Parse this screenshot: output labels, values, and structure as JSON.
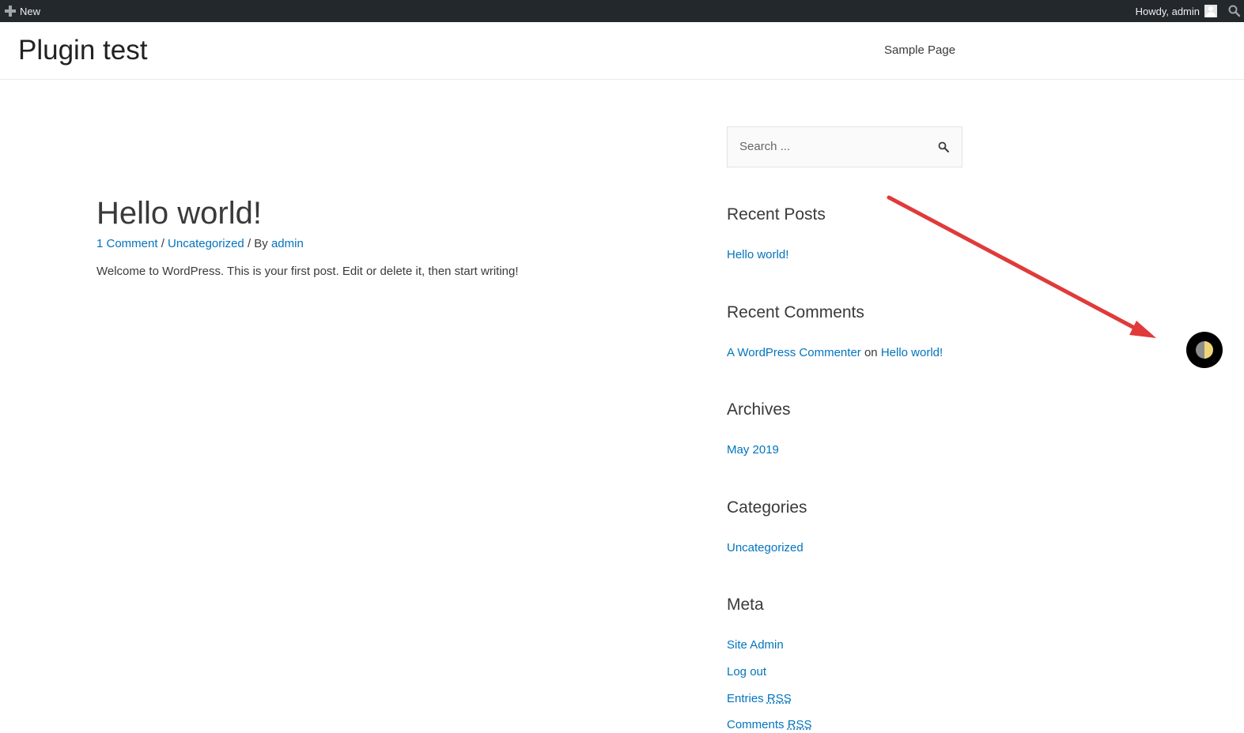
{
  "admin_bar": {
    "new_label": "New",
    "howdy": "Howdy, admin"
  },
  "site": {
    "title": "Plugin test",
    "nav": [
      "Sample Page"
    ]
  },
  "post": {
    "title": "Hello world!",
    "meta": {
      "comments": "1 Comment",
      "sep1": " / ",
      "category": "Uncategorized",
      "sep2": " / By ",
      "author": "admin"
    },
    "excerpt": "Welcome to WordPress. This is your first post. Edit or delete it, then start writing!"
  },
  "sidebar": {
    "search_placeholder": "Search ...",
    "recent_posts": {
      "title": "Recent Posts",
      "items": [
        "Hello world!"
      ]
    },
    "recent_comments": {
      "title": "Recent Comments",
      "author": "A WordPress Commenter",
      "on": " on ",
      "post": "Hello world!"
    },
    "archives": {
      "title": "Archives",
      "items": [
        "May 2019"
      ]
    },
    "categories": {
      "title": "Categories",
      "items": [
        "Uncategorized"
      ]
    },
    "meta": {
      "title": "Meta",
      "site_admin": "Site Admin",
      "log_out": "Log out",
      "entries": "Entries ",
      "comments": "Comments ",
      "rss": "RSS"
    }
  },
  "colors": {
    "link": "#0274be",
    "admin_bar": "#23282d",
    "arrow": "#e03a3a"
  }
}
